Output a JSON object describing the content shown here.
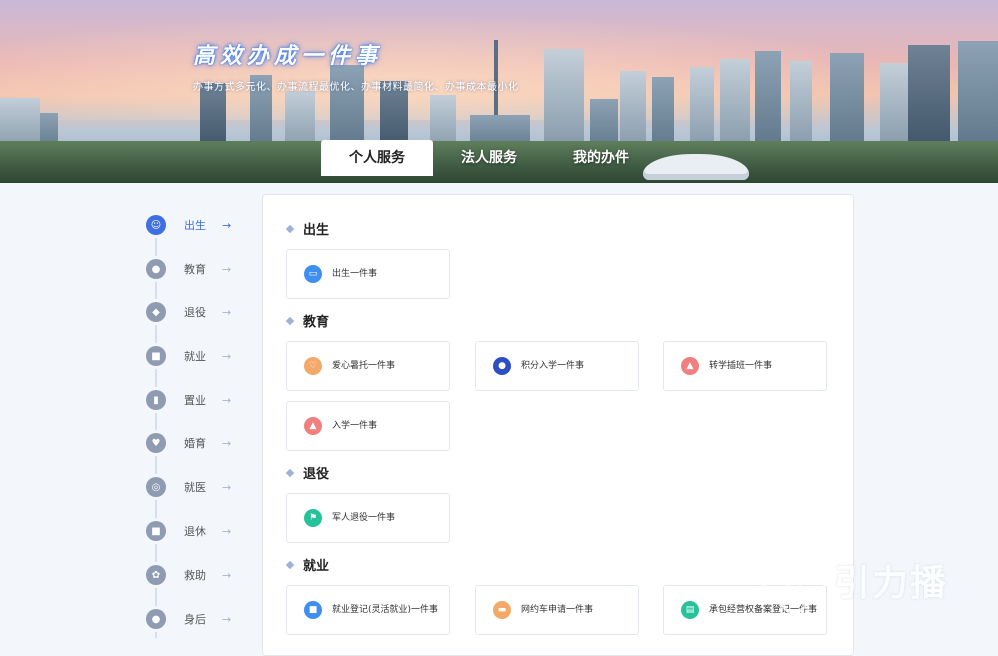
{
  "banner": {
    "title": "高效办成一件事",
    "subtitle": "办事方式多元化、办事流程最优化、办事材料最简化、办事成本最小化"
  },
  "tabs": [
    {
      "label": "个人服务",
      "active": true
    },
    {
      "label": "法人服务",
      "active": false
    },
    {
      "label": "我的办件",
      "active": false
    }
  ],
  "sidebar": {
    "items": [
      {
        "label": "出生",
        "icon": "baby-icon",
        "active": true
      },
      {
        "label": "教育",
        "icon": "student-icon",
        "active": false
      },
      {
        "label": "退役",
        "icon": "badge-icon",
        "active": false
      },
      {
        "label": "就业",
        "icon": "briefcase-icon",
        "active": false
      },
      {
        "label": "置业",
        "icon": "building-icon",
        "active": false
      },
      {
        "label": "婚育",
        "icon": "heart-icon",
        "active": false
      },
      {
        "label": "就医",
        "icon": "medical-icon",
        "active": false
      },
      {
        "label": "退休",
        "icon": "retire-icon",
        "active": false
      },
      {
        "label": "救助",
        "icon": "aid-icon",
        "active": false
      },
      {
        "label": "身后",
        "icon": "person-icon",
        "active": false
      }
    ],
    "arrow": "→"
  },
  "sections": [
    {
      "title": "出生",
      "cards": [
        {
          "label": "出生一件事",
          "icon": "stroller-icon",
          "color": "#3f8ff0"
        }
      ]
    },
    {
      "title": "教育",
      "cards": [
        {
          "label": "爱心暑托一件事",
          "icon": "heart-hand-icon",
          "color": "#f4a968"
        },
        {
          "label": "积分入学一件事",
          "icon": "location-pin-icon",
          "color": "#2d4fc5"
        },
        {
          "label": "转学插班一件事",
          "icon": "graduation-cap-icon",
          "color": "#f07f7f"
        },
        {
          "label": "入学一件事",
          "icon": "graduation-cap-icon",
          "color": "#f07f7f"
        }
      ]
    },
    {
      "title": "退役",
      "cards": [
        {
          "label": "军人退役一件事",
          "icon": "flag-icon",
          "color": "#27c29a"
        }
      ]
    },
    {
      "title": "就业",
      "cards": [
        {
          "label": "就业登记(灵活就业)一件事",
          "icon": "briefcase-icon",
          "color": "#3f8ff0"
        },
        {
          "label": "网约车申请一件事",
          "icon": "car-icon",
          "color": "#f4a968"
        },
        {
          "label": "承包经营权备案登记一件事",
          "icon": "document-icon",
          "color": "#27c29a"
        }
      ]
    }
  ],
  "watermark": {
    "text": "引力播"
  }
}
